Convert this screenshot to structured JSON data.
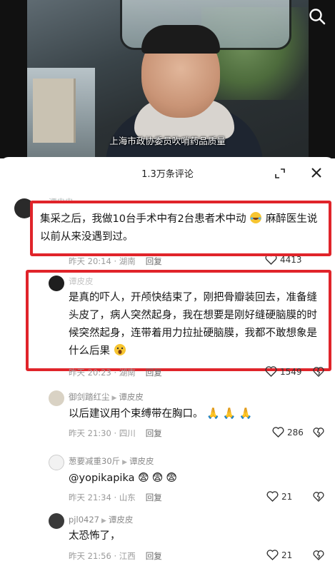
{
  "video": {
    "caption": "上海市政协委员吹哨药品质量"
  },
  "panel": {
    "title": "1.3万条评论"
  },
  "comments": [
    {
      "username": "谭忠忠",
      "text": "集采之后，我做10台手术中有2台患者术中动",
      "text_end": "麻醉医生说以前从来没遇到过。",
      "time": "昨天 20:14 · 湖南",
      "reply_label": "回复",
      "likes": "4413"
    },
    {
      "username": "谭皮皮",
      "text": "是真的吓人，开颅快结束了，刚把骨瓣装回去，准备缝头皮了，病人突然起身，我在想要是刚好缝硬脑膜的时候突然起身，连带着用力拉扯硬脑膜，我都不敢想象是什么后果",
      "time": "昨天 20:23 · 湖南",
      "reply_label": "回复",
      "likes": "1549"
    },
    {
      "username": "御剑踏红尘",
      "reply_to": "谭皮皮",
      "text": "以后建议用个束缚带在胸口。",
      "time": "昨天 21:30 · 四川",
      "reply_label": "回复",
      "likes": "286"
    },
    {
      "username": "葱要减重30斤",
      "reply_to": "谭皮皮",
      "text": "@yopikapika",
      "time": "昨天 21:34 · 山东",
      "reply_label": "回复",
      "likes": "21"
    },
    {
      "username": "pjl0427",
      "reply_to": "谭皮皮",
      "text": "太恐怖了，",
      "time": "昨天 21:56 · 江西",
      "reply_label": "回复",
      "likes": "21"
    }
  ],
  "colors": {
    "highlight_box": "#e0242a"
  },
  "icons": [
    "search-icon",
    "expand-icon",
    "close-icon",
    "heart-icon",
    "dislike-heart-icon"
  ]
}
